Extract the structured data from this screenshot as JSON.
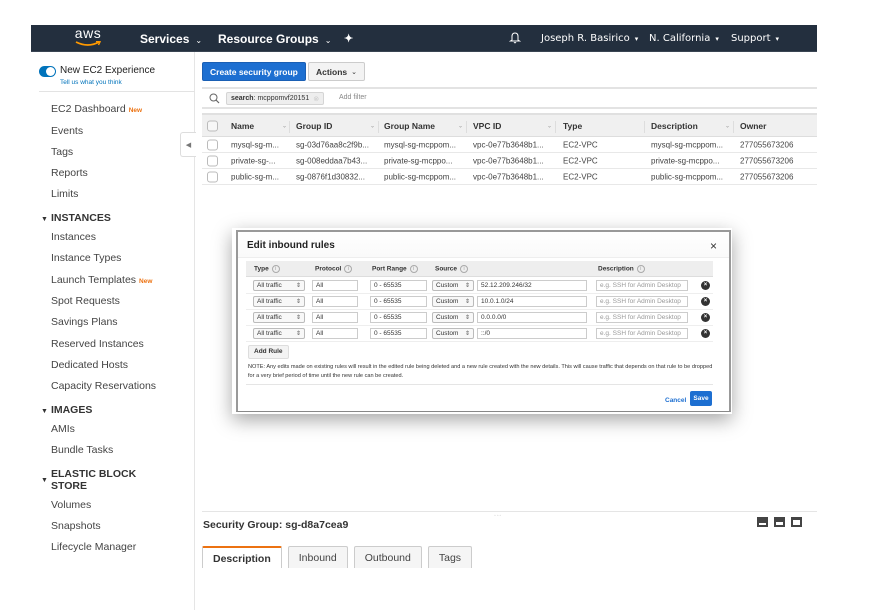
{
  "topnav": {
    "logo": "aws",
    "services": "Services",
    "resource_groups": "Resource Groups",
    "user": "Joseph R. Basirico",
    "region": "N. California",
    "support": "Support",
    "caret": "⌄"
  },
  "sidebar": {
    "experience_label": "New EC2 Experience",
    "experience_sub": "Tell us what you think",
    "top_items": [
      {
        "label": "EC2 Dashboard",
        "badge": "New"
      },
      {
        "label": "Events"
      },
      {
        "label": "Tags"
      },
      {
        "label": "Reports"
      },
      {
        "label": "Limits"
      }
    ],
    "sections": [
      {
        "title": "INSTANCES",
        "items": [
          "Instances",
          "Instance Types",
          "Launch Templates",
          "Spot Requests",
          "Savings Plans",
          "Reserved Instances",
          "Dedicated Hosts",
          "Capacity Reservations"
        ],
        "badges": {
          "Launch Templates": "New"
        }
      },
      {
        "title": "IMAGES",
        "items": [
          "AMIs",
          "Bundle Tasks"
        ]
      },
      {
        "title_line1": "ELASTIC BLOCK",
        "title_line2": "STORE",
        "items": [
          "Volumes",
          "Snapshots",
          "Lifecycle Manager"
        ]
      }
    ],
    "badge_new": "New"
  },
  "toolbar": {
    "create_label": "Create security group",
    "actions_label": "Actions"
  },
  "search": {
    "token_key": "search",
    "token_value": ": mcppomvf20151",
    "add_filter": "Add filter"
  },
  "table": {
    "columns": [
      "Name",
      "Group ID",
      "Group Name",
      "VPC ID",
      "Type",
      "Description",
      "Owner"
    ],
    "rows": [
      [
        "mysql-sg-m...",
        "sg-03d76aa8c2f9b...",
        "mysql-sg-mcppom...",
        "vpc-0e77b3648b1...",
        "EC2-VPC",
        "mysql-sg-mcppom...",
        "277055673206"
      ],
      [
        "private-sg-...",
        "sg-008eddaa7b43...",
        "private-sg-mcppo...",
        "vpc-0e77b3648b1...",
        "EC2-VPC",
        "private-sg-mcppo...",
        "277055673206"
      ],
      [
        "public-sg-m...",
        "sg-0876f1d30832...",
        "public-sg-mcppom...",
        "vpc-0e77b3648b1...",
        "EC2-VPC",
        "public-sg-mcppom...",
        "277055673206"
      ]
    ]
  },
  "modal": {
    "title": "Edit inbound rules",
    "close": "×",
    "columns": [
      "Type",
      "Protocol",
      "Port Range",
      "Source",
      "Description"
    ],
    "info": "i",
    "rules": [
      {
        "type": "All traffic",
        "protocol": "All",
        "port_range": "0 - 65535",
        "source_type": "Custom",
        "source": "52.12.209.246/32",
        "description_placeholder": "e.g. SSH for Admin Desktop"
      },
      {
        "type": "All traffic",
        "protocol": "All",
        "port_range": "0 - 65535",
        "source_type": "Custom",
        "source": "10.0.1.0/24",
        "description_placeholder": "e.g. SSH for Admin Desktop"
      },
      {
        "type": "All traffic",
        "protocol": "All",
        "port_range": "0 - 65535",
        "source_type": "Custom",
        "source": "0.0.0.0/0",
        "description_placeholder": "e.g. SSH for Admin Desktop"
      },
      {
        "type": "All traffic",
        "protocol": "All",
        "port_range": "0 - 65535",
        "source_type": "Custom",
        "source": "::/0",
        "description_placeholder": "e.g. SSH for Admin Desktop"
      }
    ],
    "add_rule": "Add Rule",
    "note": "NOTE: Any edits made on existing rules will result in the edited rule being deleted and a new rule created with the new details. This will cause traffic that depends on that rule to be dropped for a very brief period of time until the new rule can be created.",
    "cancel": "Cancel",
    "save": "Save"
  },
  "detail": {
    "title": "Security Group: sg-d8a7cea9",
    "tabs": [
      "Description",
      "Inbound",
      "Outbound",
      "Tags"
    ],
    "active_tab": "Description"
  },
  "colors": {
    "nav_bg": "#232f3e",
    "primary": "#1d6fd1",
    "badge_orange": "#ec7211",
    "toggle_blue": "#0073bb"
  }
}
